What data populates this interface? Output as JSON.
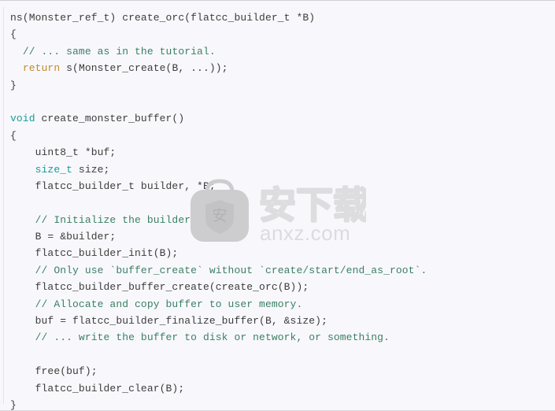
{
  "code_block": {
    "language": "c",
    "background_color": "#f8f8fc",
    "text_color": "#3c3c3c",
    "comment_color": "#3a7f63",
    "keyword_color": "#c08a2e",
    "type_color": "#179a9a",
    "lines": [
      {
        "id": "line-1",
        "indent": 0,
        "tokens": [
          {
            "t": "plain",
            "v": "ns(Monster_ref_t) create_orc(flatcc_builder_t *B)"
          }
        ]
      },
      {
        "id": "line-2",
        "indent": 0,
        "tokens": [
          {
            "t": "plain",
            "v": "{"
          }
        ]
      },
      {
        "id": "line-3",
        "indent": 2,
        "tokens": [
          {
            "t": "comment",
            "v": "// ... same as in the tutorial."
          }
        ]
      },
      {
        "id": "line-4",
        "indent": 2,
        "tokens": [
          {
            "t": "keyword",
            "v": "return"
          },
          {
            "t": "plain",
            "v": " s(Monster_create(B, ...));"
          }
        ]
      },
      {
        "id": "line-5",
        "indent": 0,
        "tokens": [
          {
            "t": "plain",
            "v": "}"
          }
        ]
      },
      {
        "id": "line-6",
        "indent": 0,
        "tokens": [
          {
            "t": "plain",
            "v": ""
          }
        ]
      },
      {
        "id": "line-7",
        "indent": 0,
        "tokens": [
          {
            "t": "type",
            "v": "void"
          },
          {
            "t": "plain",
            "v": " create_monster_buffer()"
          }
        ]
      },
      {
        "id": "line-8",
        "indent": 0,
        "tokens": [
          {
            "t": "plain",
            "v": "{"
          }
        ]
      },
      {
        "id": "line-9",
        "indent": 4,
        "tokens": [
          {
            "t": "plain",
            "v": "uint8_t *buf;"
          }
        ]
      },
      {
        "id": "line-10",
        "indent": 4,
        "tokens": [
          {
            "t": "type",
            "v": "size_t"
          },
          {
            "t": "plain",
            "v": " size;"
          }
        ]
      },
      {
        "id": "line-11",
        "indent": 4,
        "tokens": [
          {
            "t": "plain",
            "v": "flatcc_builder_t builder, *B;"
          }
        ]
      },
      {
        "id": "line-12",
        "indent": 0,
        "tokens": [
          {
            "t": "plain",
            "v": ""
          }
        ]
      },
      {
        "id": "line-13",
        "indent": 4,
        "tokens": [
          {
            "t": "comment",
            "v": "// Initialize the builder object."
          }
        ]
      },
      {
        "id": "line-14",
        "indent": 4,
        "tokens": [
          {
            "t": "plain",
            "v": "B = &builder;"
          }
        ]
      },
      {
        "id": "line-15",
        "indent": 4,
        "tokens": [
          {
            "t": "plain",
            "v": "flatcc_builder_init(B);"
          }
        ]
      },
      {
        "id": "line-16",
        "indent": 4,
        "tokens": [
          {
            "t": "comment",
            "v": "// Only use `buffer_create` without `create/start/end_as_root`."
          }
        ]
      },
      {
        "id": "line-17",
        "indent": 4,
        "tokens": [
          {
            "t": "plain",
            "v": "flatcc_builder_buffer_create(create_orc(B));"
          }
        ]
      },
      {
        "id": "line-18",
        "indent": 4,
        "tokens": [
          {
            "t": "comment",
            "v": "// Allocate and copy buffer to user memory."
          }
        ]
      },
      {
        "id": "line-19",
        "indent": 4,
        "tokens": [
          {
            "t": "plain",
            "v": "buf = flatcc_builder_finalize_buffer(B, &size);"
          }
        ]
      },
      {
        "id": "line-20",
        "indent": 4,
        "tokens": [
          {
            "t": "comment",
            "v": "// ... write the buffer to disk or network, or something."
          }
        ]
      },
      {
        "id": "line-21",
        "indent": 0,
        "tokens": [
          {
            "t": "plain",
            "v": ""
          }
        ]
      },
      {
        "id": "line-22",
        "indent": 4,
        "tokens": [
          {
            "t": "plain",
            "v": "free(buf);"
          }
        ]
      },
      {
        "id": "line-23",
        "indent": 4,
        "tokens": [
          {
            "t": "plain",
            "v": "flatcc_builder_clear(B);"
          }
        ]
      },
      {
        "id": "line-24",
        "indent": 0,
        "tokens": [
          {
            "t": "plain",
            "v": "}"
          }
        ]
      }
    ]
  },
  "watermark": {
    "icon_name": "bag-shield-icon",
    "shield_glyph": "安",
    "logo_text": "安下载",
    "site_text": "anxz.com",
    "color": "#d6d6d9"
  }
}
